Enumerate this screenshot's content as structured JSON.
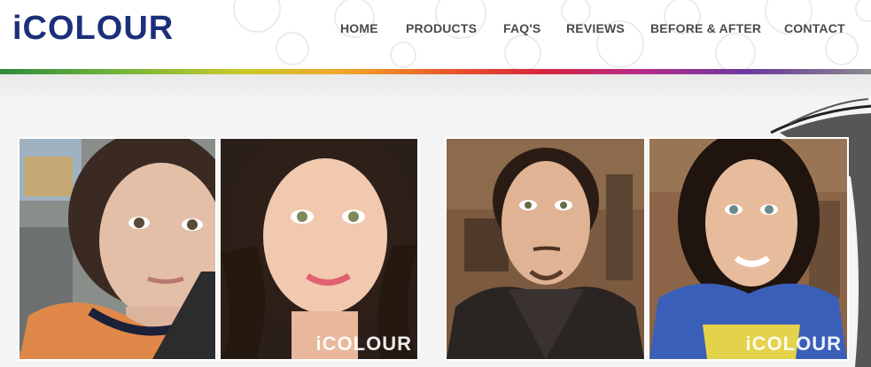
{
  "brand": {
    "logo_text": "iCOLOUR"
  },
  "nav": {
    "items": [
      {
        "label": "HOME"
      },
      {
        "label": "PRODUCTS"
      },
      {
        "label": "FAQ'S"
      },
      {
        "label": "REVIEWS"
      },
      {
        "label": "BEFORE & AFTER"
      },
      {
        "label": "CONTACT"
      }
    ]
  },
  "gallery": {
    "watermark": "iCOLOUR",
    "photos": [
      {
        "name": "woman-before"
      },
      {
        "name": "woman-after"
      },
      {
        "name": "man-before"
      },
      {
        "name": "man-after"
      }
    ]
  },
  "colors": {
    "brand": "#1d2f7a",
    "nav_text": "#4a4a4a",
    "background": "#f4f4f4"
  }
}
